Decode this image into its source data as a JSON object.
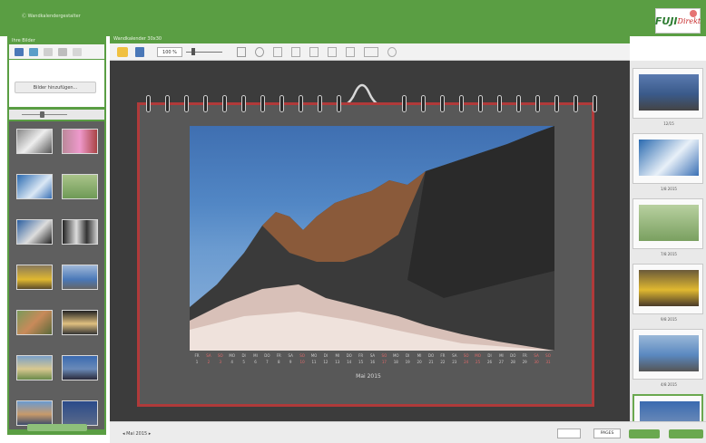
{
  "app": {
    "title": "Ⓒ Wandkalendergestalter",
    "logo_main": "FUJI",
    "logo_sub": "Direkt"
  },
  "left_panel": {
    "header": "Ihre Bilder",
    "upload_button": "Bilder hinzufügen...",
    "tool_icons": [
      "folder-icon",
      "camera-icon",
      "search-icon",
      "monitor-icon",
      "cloud-icon"
    ]
  },
  "center": {
    "title": "Wandkalender 30x30",
    "zoom_value": "100 %",
    "toolbar_icons": [
      "folder-icon",
      "save-icon",
      "zoom-out-icon",
      "zoom-in-icon",
      "layout-icon",
      "frame-icon",
      "text-icon",
      "crop-icon",
      "rotate-icon",
      "brush-icon",
      "effect-icon",
      "grid-icon",
      "settings-icon"
    ]
  },
  "calendar": {
    "month": "Mai 2015",
    "days": [
      "FR",
      "SA",
      "SO",
      "MO",
      "DI",
      "MI",
      "DO",
      "FR",
      "SA",
      "SO",
      "MO",
      "DI",
      "MI",
      "DO",
      "FR",
      "SA",
      "SO",
      "MO",
      "DI",
      "MI",
      "DO",
      "FR",
      "SA",
      "SO",
      "MO",
      "DI",
      "MI",
      "DO",
      "FR",
      "SA",
      "SO"
    ],
    "numbers": [
      "1",
      "2",
      "3",
      "4",
      "5",
      "6",
      "7",
      "8",
      "9",
      "10",
      "11",
      "12",
      "13",
      "14",
      "15",
      "16",
      "17",
      "18",
      "19",
      "20",
      "21",
      "22",
      "23",
      "24",
      "25",
      "26",
      "27",
      "28",
      "29",
      "30",
      "31"
    ],
    "red_indices": [
      1,
      2,
      9,
      16,
      23,
      24,
      29,
      30
    ]
  },
  "right_panel": {
    "pages": [
      {
        "label": "12/15"
      },
      {
        "label": "1/8 2015"
      },
      {
        "label": "7/8 2015"
      },
      {
        "label": "9/8 2015"
      },
      {
        "label": "4/8 2015"
      },
      {
        "label": ""
      }
    ]
  },
  "bottom": {
    "page_nav": "Mai 2015",
    "pages_button": "PAGES"
  },
  "colors": {
    "brand_green": "#5a9e43",
    "frame_red": "#b03a3a",
    "canvas": "#3c3c3c"
  }
}
